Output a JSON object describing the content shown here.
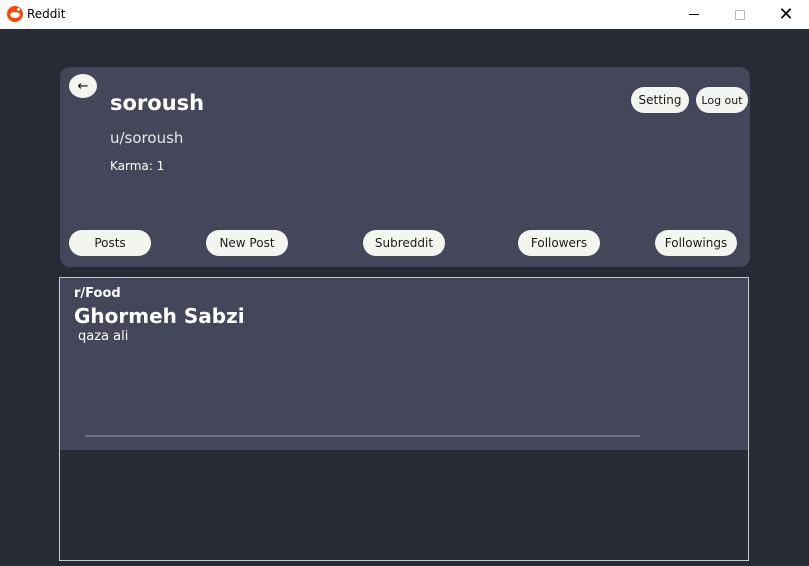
{
  "window": {
    "title": "Reddit",
    "minimize_glyph": "",
    "maximize_glyph": "",
    "close_glyph": "✕"
  },
  "profile": {
    "back_glyph": "←",
    "username": "soroush",
    "handle": "u/soroush",
    "karma": "Karma: 1",
    "setting_label": "Setting",
    "logout_label": "Log out"
  },
  "nav": {
    "posts": "Posts",
    "new_post": "New Post",
    "subreddit": "Subreddit",
    "followers": "Followers",
    "followings": "Followings"
  },
  "posts": [
    {
      "subreddit": "r/Food",
      "title": "Ghormeh Sabzi",
      "body": "qaza ali"
    }
  ],
  "colors": {
    "background": "#282a36",
    "card": "#44465a",
    "pill": "#f5f5f0",
    "brand": "#ff4500"
  }
}
